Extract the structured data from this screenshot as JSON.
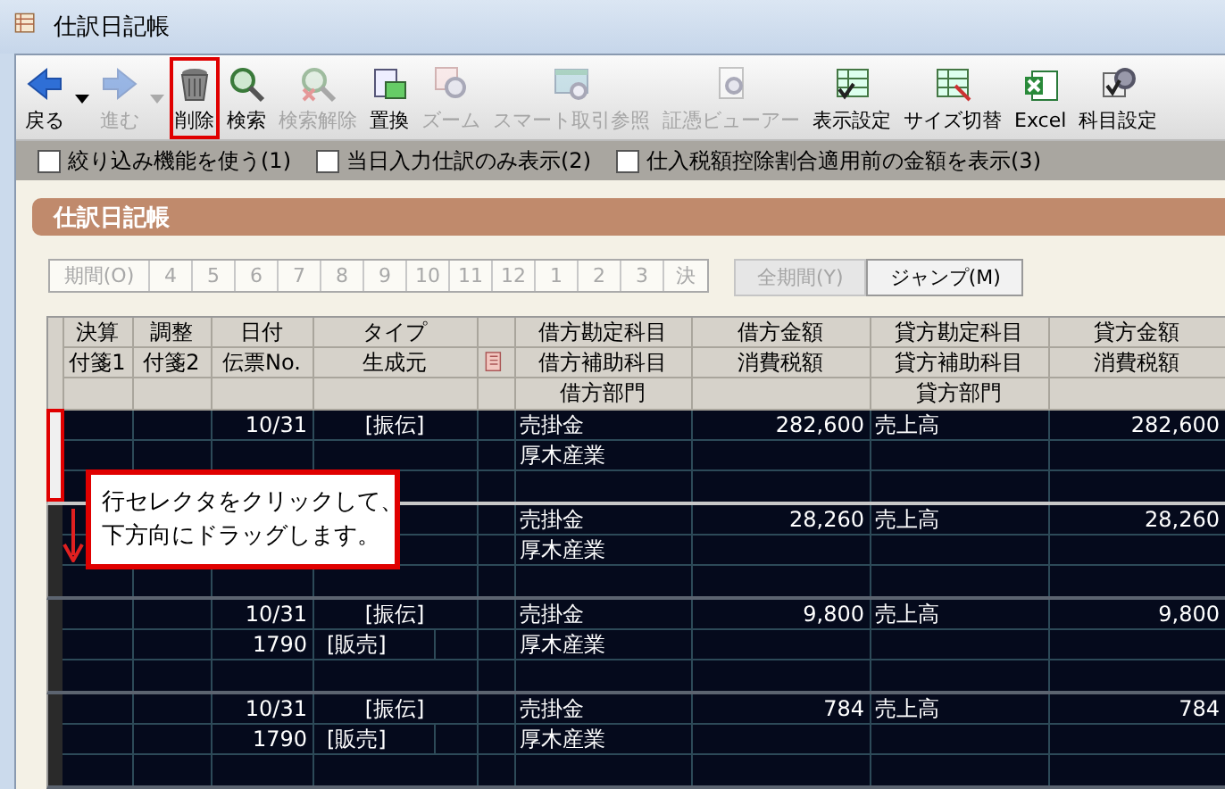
{
  "window": {
    "title": "仕訳日記帳"
  },
  "toolbar": [
    {
      "label": "戻る",
      "kind": "back",
      "disabled": false,
      "dropdown": true,
      "highlighted": false
    },
    {
      "label": "進む",
      "kind": "forward",
      "disabled": true,
      "dropdown": true,
      "highlighted": false
    },
    {
      "label": "削除",
      "kind": "delete",
      "disabled": false,
      "dropdown": false,
      "highlighted": true
    },
    {
      "label": "検索",
      "kind": "search",
      "disabled": false,
      "dropdown": false,
      "highlighted": false
    },
    {
      "label": "検索解除",
      "kind": "search_clear",
      "disabled": true,
      "dropdown": false,
      "highlighted": false
    },
    {
      "label": "置換",
      "kind": "replace",
      "disabled": false,
      "dropdown": false,
      "highlighted": false
    },
    {
      "label": "ズーム",
      "kind": "zoom",
      "disabled": true,
      "dropdown": false,
      "highlighted": false
    },
    {
      "label": "スマート取引参照",
      "kind": "smart",
      "disabled": true,
      "dropdown": false,
      "highlighted": false
    },
    {
      "label": "証憑ビューアー",
      "kind": "viewer",
      "disabled": true,
      "dropdown": false,
      "highlighted": false
    },
    {
      "label": "表示設定",
      "kind": "display",
      "disabled": false,
      "dropdown": false,
      "highlighted": false
    },
    {
      "label": "サイズ切替",
      "kind": "size",
      "disabled": false,
      "dropdown": false,
      "highlighted": false
    },
    {
      "label": "Excel",
      "kind": "excel",
      "disabled": false,
      "dropdown": false,
      "highlighted": false
    },
    {
      "label": "科目設定",
      "kind": "account",
      "disabled": false,
      "dropdown": false,
      "highlighted": false
    }
  ],
  "options": [
    {
      "label": "絞り込み機能を使う(1)",
      "checked": false
    },
    {
      "label": "当日入力仕訳のみ表示(2)",
      "checked": false
    },
    {
      "label": "仕入税額控除割合適用前の金額を表示(3)",
      "checked": false
    }
  ],
  "panel_title": "仕訳日記帳",
  "period_buttons": [
    {
      "label": "期間(O)",
      "disabled": true
    },
    {
      "label": "4",
      "disabled": true
    },
    {
      "label": "5",
      "disabled": true
    },
    {
      "label": "6",
      "disabled": true
    },
    {
      "label": "7",
      "disabled": true
    },
    {
      "label": "8",
      "disabled": true
    },
    {
      "label": "9",
      "disabled": true
    },
    {
      "label": "10",
      "disabled": true
    },
    {
      "label": "11",
      "disabled": true
    },
    {
      "label": "12",
      "disabled": true
    },
    {
      "label": "1",
      "disabled": true
    },
    {
      "label": "2",
      "disabled": true
    },
    {
      "label": "3",
      "disabled": true
    },
    {
      "label": "決",
      "disabled": true
    }
  ],
  "buttons": [
    {
      "label": "全期間(Y)",
      "disabled": true
    },
    {
      "label": "ジャンプ(M)",
      "disabled": false
    }
  ],
  "table": {
    "columns": [
      {
        "kind": "text",
        "labels": [
          "決算",
          "付箋1"
        ]
      },
      {
        "kind": "text",
        "labels": [
          "調整",
          "付箋2"
        ]
      },
      {
        "kind": "text",
        "labels": [
          "日付",
          "伝票No."
        ]
      },
      {
        "kind": "text",
        "labels": [
          "タイプ",
          "生成元"
        ]
      },
      {
        "kind": "icon"
      },
      {
        "kind": "text",
        "labels": [
          "借方勘定科目",
          "借方補助科目",
          "借方部門"
        ]
      },
      {
        "kind": "text",
        "labels": [
          "借方金額",
          "消費税額"
        ]
      },
      {
        "kind": "text",
        "labels": [
          "貸方勘定科目",
          "貸方補助科目",
          "貸方部門"
        ]
      },
      {
        "kind": "text",
        "labels": [
          "貸方金額",
          "消費税額"
        ]
      }
    ],
    "rows": [
      {
        "selected": true,
        "date": "10/31",
        "type": "[振伝]",
        "debit_account": "売掛金",
        "debit_amount": "282,600",
        "credit_account": "売上高",
        "credit_amount": "282,600",
        "debit_sub": "厚木産業"
      },
      {
        "selected": false,
        "debit_account": "売掛金",
        "debit_amount": "28,260",
        "credit_account": "売上高",
        "credit_amount": "28,260",
        "debit_sub": "厚木産業"
      },
      {
        "selected": false,
        "date": "10/31",
        "type": "[振伝]",
        "voucher": "1790",
        "source": "[販売]",
        "debit_account": "売掛金",
        "debit_amount": "9,800",
        "credit_account": "売上高",
        "credit_amount": "9,800",
        "debit_sub": "厚木産業"
      },
      {
        "selected": false,
        "date": "10/31",
        "type": "[振伝]",
        "voucher": "1790",
        "source": "[販売]",
        "debit_account": "売掛金",
        "debit_amount": "784",
        "credit_account": "売上高",
        "credit_amount": "784",
        "debit_sub": "厚木産業"
      }
    ]
  },
  "callout": {
    "lines": [
      "行セレクタをクリックして、",
      "下方向にドラッグします。"
    ]
  }
}
